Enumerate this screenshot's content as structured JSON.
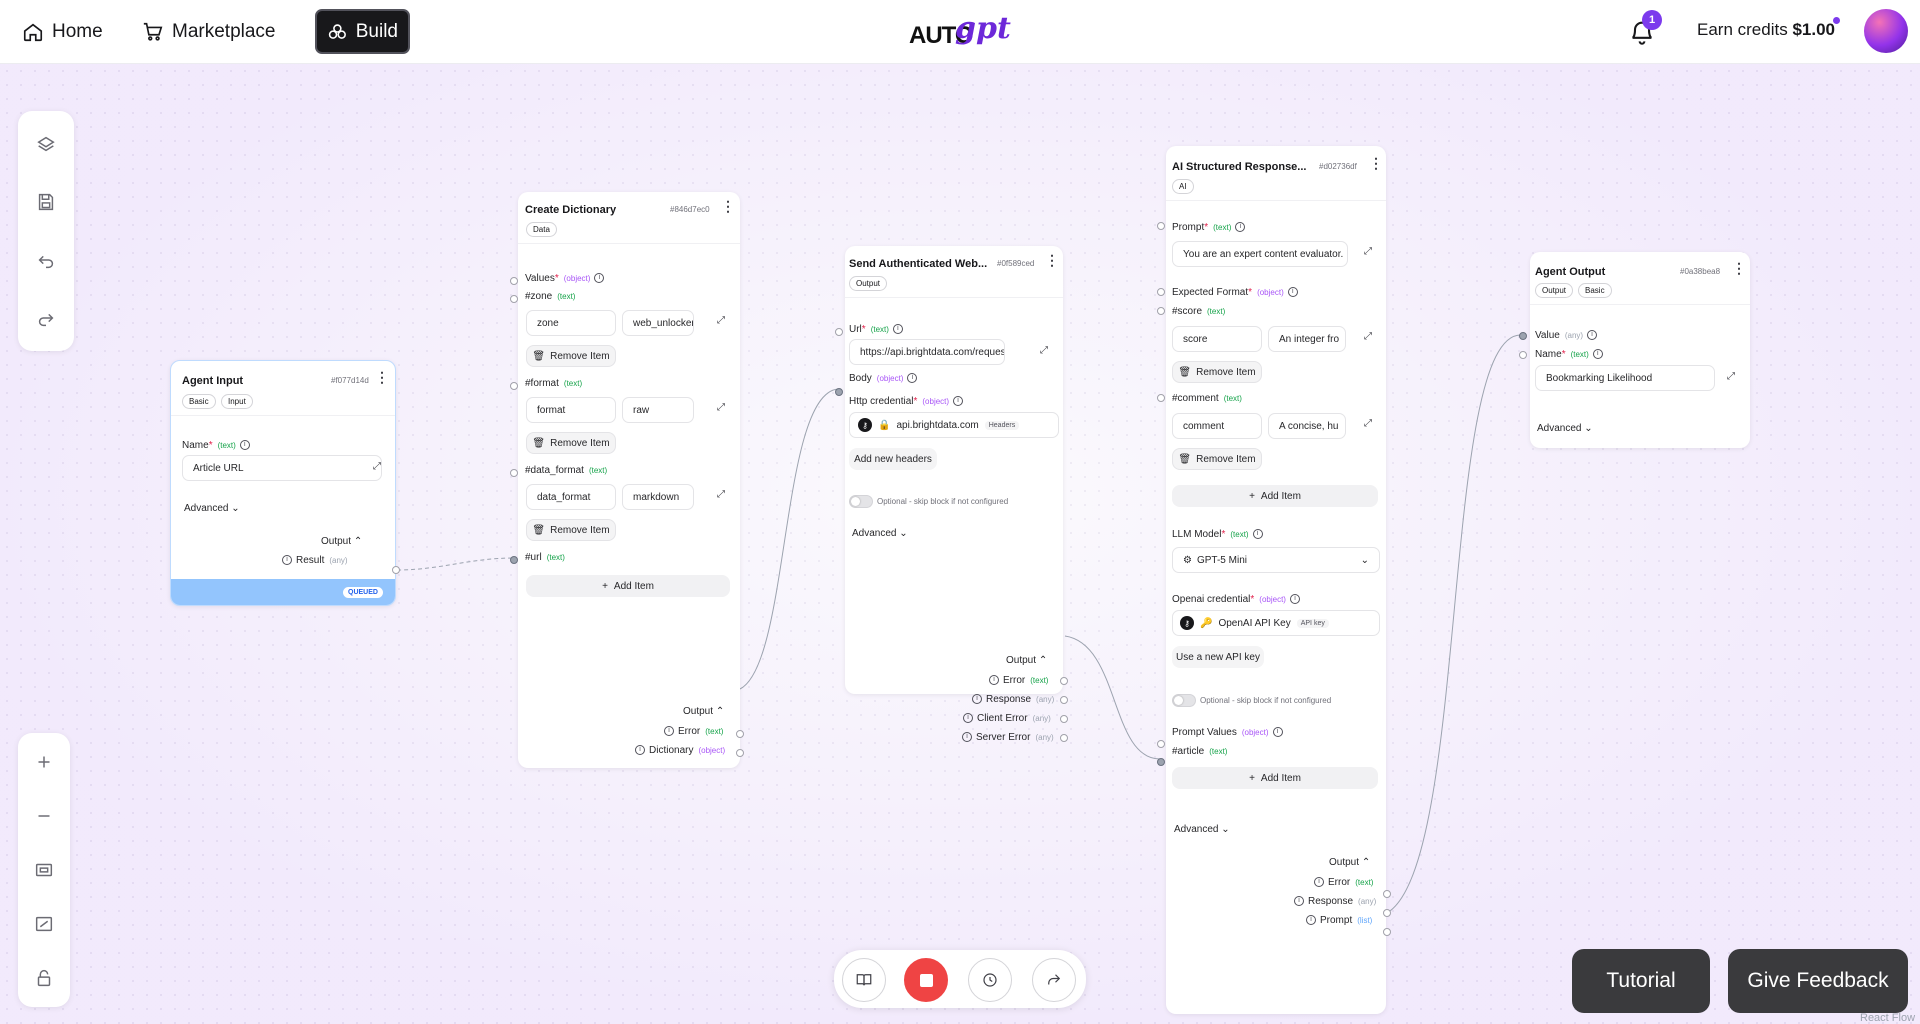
{
  "nav": {
    "home_label": "Home",
    "marketplace_label": "Marketplace",
    "build_label": "Build",
    "logo_main": "AUTO",
    "logo_script": "gpt",
    "notification_count": "1",
    "credits_prefix": "Earn credits",
    "credits_value": "$1.00"
  },
  "toolbar_top": [
    "blocks-icon",
    "save-icon",
    "undo-icon",
    "redo-icon"
  ],
  "toolbar_bottom": [
    "zoom-in-icon",
    "zoom-out-icon",
    "fit-view-icon",
    "fullscreen-icon",
    "lock-icon"
  ],
  "nodes": {
    "agent_input": {
      "title": "Agent Input",
      "id": "#f077d14d",
      "tags": [
        "Basic",
        "Input"
      ],
      "name_label": "Name",
      "name_type": "(text)",
      "name_value": "Article URL",
      "advanced": "Advanced",
      "output": "Output",
      "result_label": "Result",
      "result_type": "(any)",
      "status": "QUEUED"
    },
    "create_dictionary": {
      "title": "Create Dictionary",
      "id": "#846d7ec0",
      "tag": "Data",
      "values_label": "Values",
      "values_type": "(object)",
      "entries": [
        {
          "key_label": "#zone",
          "type": "(text)",
          "key": "zone",
          "value": "web_unlocker"
        },
        {
          "key_label": "#format",
          "type": "(text)",
          "key": "format",
          "value": "raw"
        },
        {
          "key_label": "#data_format",
          "type": "(text)",
          "key": "data_format",
          "value": "markdown"
        }
      ],
      "remove_label": "Remove Item",
      "url_label": "#url",
      "url_type": "(text)",
      "add_label": "Add Item",
      "output": "Output",
      "error_label": "Error",
      "error_type": "(text)",
      "dict_label": "Dictionary",
      "dict_type": "(object)"
    },
    "send_web": {
      "title": "Send Authenticated Web...",
      "id": "#0f589ced",
      "tag": "Output",
      "url_label": "Url",
      "url_type": "(text)",
      "url_value": "https://api.brightdata.com/request",
      "body_label": "Body",
      "body_type": "(object)",
      "cred_label": "Http credential",
      "cred_type": "(object)",
      "cred_value": "api.brightdata.com",
      "cred_badge": "Headers",
      "add_headers": "Add new headers",
      "optional_note": "Optional - skip block if not configured",
      "advanced": "Advanced",
      "output": "Output",
      "outputs": [
        {
          "label": "Error",
          "type": "(text)"
        },
        {
          "label": "Response",
          "type": "(any)"
        },
        {
          "label": "Client Error",
          "type": "(any)"
        },
        {
          "label": "Server Error",
          "type": "(any)"
        }
      ]
    },
    "ai_structured": {
      "title": "AI Structured Response...",
      "id": "#d02736df",
      "tag": "AI",
      "prompt_label": "Prompt",
      "prompt_type": "(text)",
      "prompt_value": "You are an expert content evaluator.",
      "expected_label": "Expected Format",
      "expected_type": "(object)",
      "entries": [
        {
          "key_label": "#score",
          "type": "(text)",
          "key": "score",
          "value": "An integer fro"
        },
        {
          "key_label": "#comment",
          "type": "(text)",
          "key": "comment",
          "value": "A concise, hu"
        }
      ],
      "remove_label": "Remove Item",
      "add_label": "Add Item",
      "llm_label": "LLM Model",
      "llm_type": "(text)",
      "llm_value": "GPT-5 Mini",
      "openai_label": "Openai credential",
      "openai_type": "(object)",
      "openai_value": "OpenAI API Key",
      "openai_badge": "API key",
      "use_new_key": "Use a new API key",
      "optional_note": "Optional - skip block if not configured",
      "prompt_values_label": "Prompt Values",
      "prompt_values_type": "(object)",
      "article_label": "#article",
      "article_type": "(text)",
      "add_label2": "Add Item",
      "advanced": "Advanced",
      "output": "Output",
      "outputs": [
        {
          "label": "Error",
          "type": "(text)"
        },
        {
          "label": "Response",
          "type": "(any)"
        },
        {
          "label": "Prompt",
          "type": "(list)"
        }
      ]
    },
    "agent_output": {
      "title": "Agent Output",
      "id": "#0a38bea8",
      "tags": [
        "Output",
        "Basic"
      ],
      "value_label": "Value",
      "value_type": "(any)",
      "name_label": "Name",
      "name_type": "(text)",
      "name_value": "Bookmarking Likelihood",
      "advanced": "Advanced"
    }
  },
  "bottom_bar": [
    "guide-icon",
    "stop-icon",
    "history-icon",
    "share-icon"
  ],
  "tutorial_label": "Tutorial",
  "feedback_label": "Give Feedback",
  "react_flow_label": "React Flow",
  "colors": {
    "accent": "#7c3aed",
    "stop": "#ef4444",
    "queued": "#93c5fd"
  }
}
